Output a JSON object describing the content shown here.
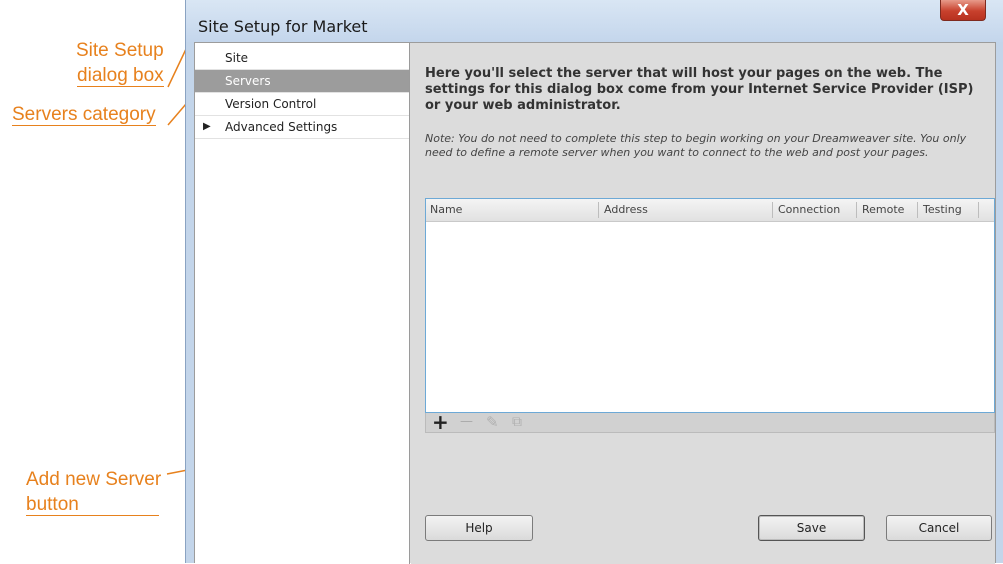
{
  "callouts": {
    "site_setup_line1": "Site Setup",
    "site_setup_line2": "dialog box",
    "servers_category": "Servers category",
    "add_server_line1": "Add new Server",
    "add_server_line2": "button",
    "color": "#e7811d"
  },
  "dialog": {
    "title": "Site Setup for Market",
    "close_label": "X"
  },
  "sidebar": {
    "items": [
      {
        "label": "Site",
        "selected": false
      },
      {
        "label": "Servers",
        "selected": true
      },
      {
        "label": "Version Control",
        "selected": false
      },
      {
        "label": "Advanced Settings",
        "selected": false,
        "expand_icon": "triangle-right-icon"
      }
    ]
  },
  "main": {
    "description": "Here you'll select the server that will host your pages on the web. The settings for this dialog box come from your Internet Service Provider (ISP) or your web administrator.",
    "note": "Note: You do not need to complete this step to begin working on your Dreamweaver site. You only need to define a remote server when you want to connect to the web and post your pages.",
    "table": {
      "columns": [
        "Name",
        "Address",
        "Connection",
        "Remote",
        "Testing"
      ],
      "rows": []
    },
    "toolbar": {
      "icons": [
        "plus-icon",
        "minus-icon",
        "pencil-icon",
        "duplicate-icon"
      ],
      "add_symbol": "+",
      "remove_symbol": "—",
      "edit_symbol": "✎",
      "duplicate_symbol": "⧉"
    }
  },
  "buttons": {
    "help": "Help",
    "save": "Save",
    "cancel": "Cancel"
  }
}
